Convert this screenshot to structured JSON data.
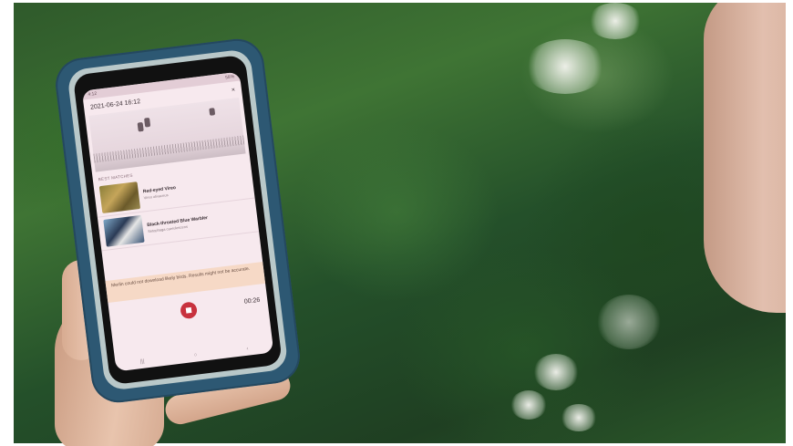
{
  "screen": {
    "status_time": "4:12",
    "status_right": "58%",
    "title": "2021-06-24 16:12",
    "close_glyph": "×",
    "section_label": "BEST MATCHES",
    "results": [
      {
        "species": "Red-eyed Vireo",
        "scientific": "Vireo olivaceus"
      },
      {
        "species": "Black-throated Blue Warbler",
        "scientific": "Setophaga caerulescens"
      }
    ],
    "note": "Merlin could not download likely birds. Results might not be accurate.",
    "timer": "00:26",
    "nav": {
      "back": "‹",
      "home": "○",
      "recents": "|||"
    }
  },
  "colors": {
    "case": "#2d5873",
    "stop_button": "#c8323e",
    "screen_bg": "#f7e9ee"
  },
  "icons": [
    "stop-icon",
    "close-icon",
    "battery-icon"
  ]
}
